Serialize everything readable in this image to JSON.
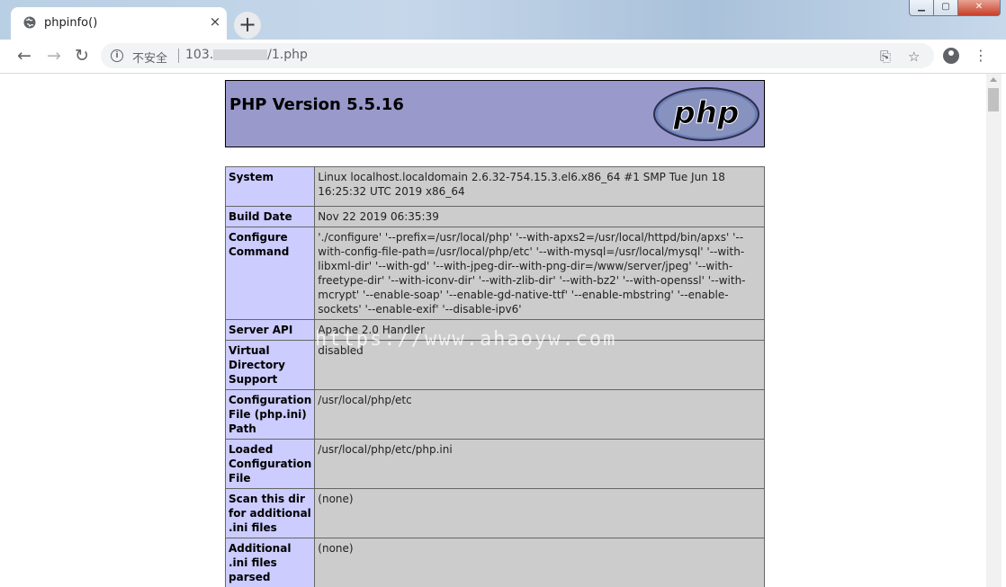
{
  "browser": {
    "tab_title": "phpinfo()",
    "tab_close": "×",
    "new_tab": "+",
    "security_label": "不安全",
    "url_prefix": "103.",
    "url_suffix": "/1.php"
  },
  "page": {
    "php_version_title": "PHP Version 5.5.16",
    "logo_text": "php",
    "rows": [
      {
        "key": "System",
        "value": "Linux localhost.localdomain 2.6.32-754.15.3.el6.x86_64 #1 SMP Tue Jun 18 16:25:32 UTC 2019 x86_64"
      },
      {
        "key": "Build Date",
        "value": "Nov 22 2019 06:35:39"
      },
      {
        "key": "Configure Command",
        "value": "'./configure' '--prefix=/usr/local/php' '--with-apxs2=/usr/local/httpd/bin/apxs' '--with-config-file-path=/usr/local/php/etc' '--with-mysql=/usr/local/mysql' '--with-libxml-dir' '--with-gd' '--with-jpeg-dir--with-png-dir=/www/server/jpeg' '--with-freetype-dir' '--with-iconv-dir' '--with-zlib-dir' '--with-bz2' '--with-openssl' '--with-mcrypt' '--enable-soap' '--enable-gd-native-ttf' '--enable-mbstring' '--enable-sockets' '--enable-exif' '--disable-ipv6'"
      },
      {
        "key": "Server API",
        "value": "Apache 2.0 Handler"
      },
      {
        "key": "Virtual Directory Support",
        "value": "disabled"
      },
      {
        "key": "Configuration File (php.ini) Path",
        "value": "/usr/local/php/etc"
      },
      {
        "key": "Loaded Configuration File",
        "value": "/usr/local/php/etc/php.ini"
      },
      {
        "key": "Scan this dir for additional .ini files",
        "value": "(none)"
      },
      {
        "key": "Additional .ini files parsed",
        "value": "(none)"
      },
      {
        "key": "",
        "value": ""
      }
    ]
  },
  "watermark": "https://www.ahaoyw.com"
}
